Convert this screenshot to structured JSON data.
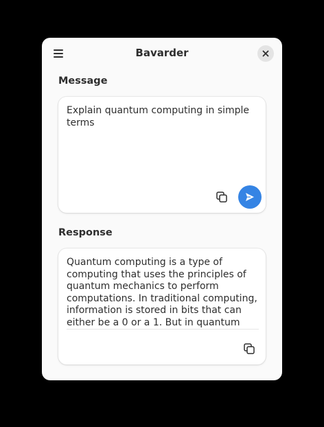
{
  "app": {
    "title": "Bavarder"
  },
  "message": {
    "label": "Message",
    "text": "Explain quantum computing in simple terms"
  },
  "response": {
    "label": "Response",
    "text": "Quantum computing is a type of computing that uses the principles of quantum mechanics to perform computations. In traditional computing, information is stored in bits that can either be a 0 or a 1. But in quantum computing, information is stored in quantum bits, or qubits, which can exist in multiple states at once."
  },
  "icons": {
    "menu": "hamburger-menu-icon",
    "close": "close-icon",
    "copy": "copy-icon",
    "send": "send-icon"
  },
  "colors": {
    "accent": "#3584e4",
    "window_bg": "#fafafa",
    "card_bg": "#ffffff",
    "text": "#2e2e2e"
  }
}
